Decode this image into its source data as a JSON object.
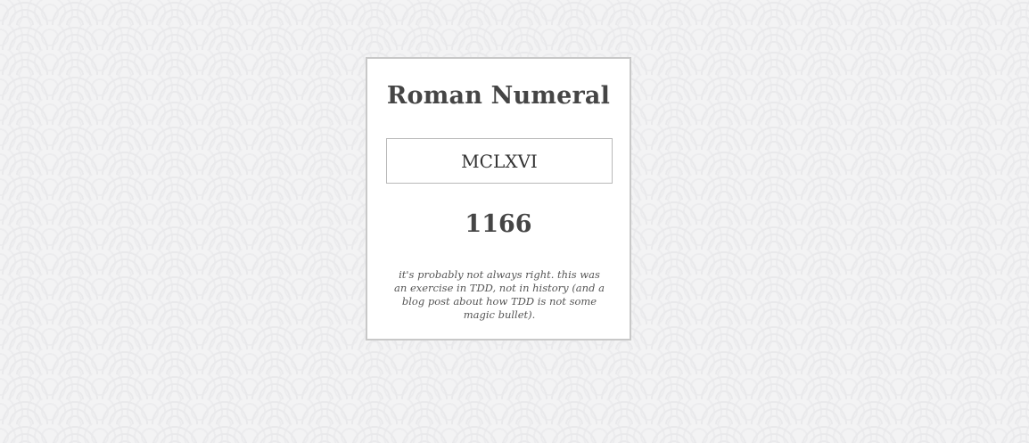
{
  "app": {
    "title": "Roman Numeral",
    "input": {
      "value": "MCLXVI",
      "placeholder": ""
    },
    "result": "1166",
    "note": "it's probably not always right. this was an exercise in TDD, not in history (and a blog post about how TDD is not some magic bullet)."
  },
  "colors": {
    "background": "#f3f3f4",
    "card": "#ffffff",
    "card_border": "#c8c8c8",
    "text": "#454545"
  }
}
